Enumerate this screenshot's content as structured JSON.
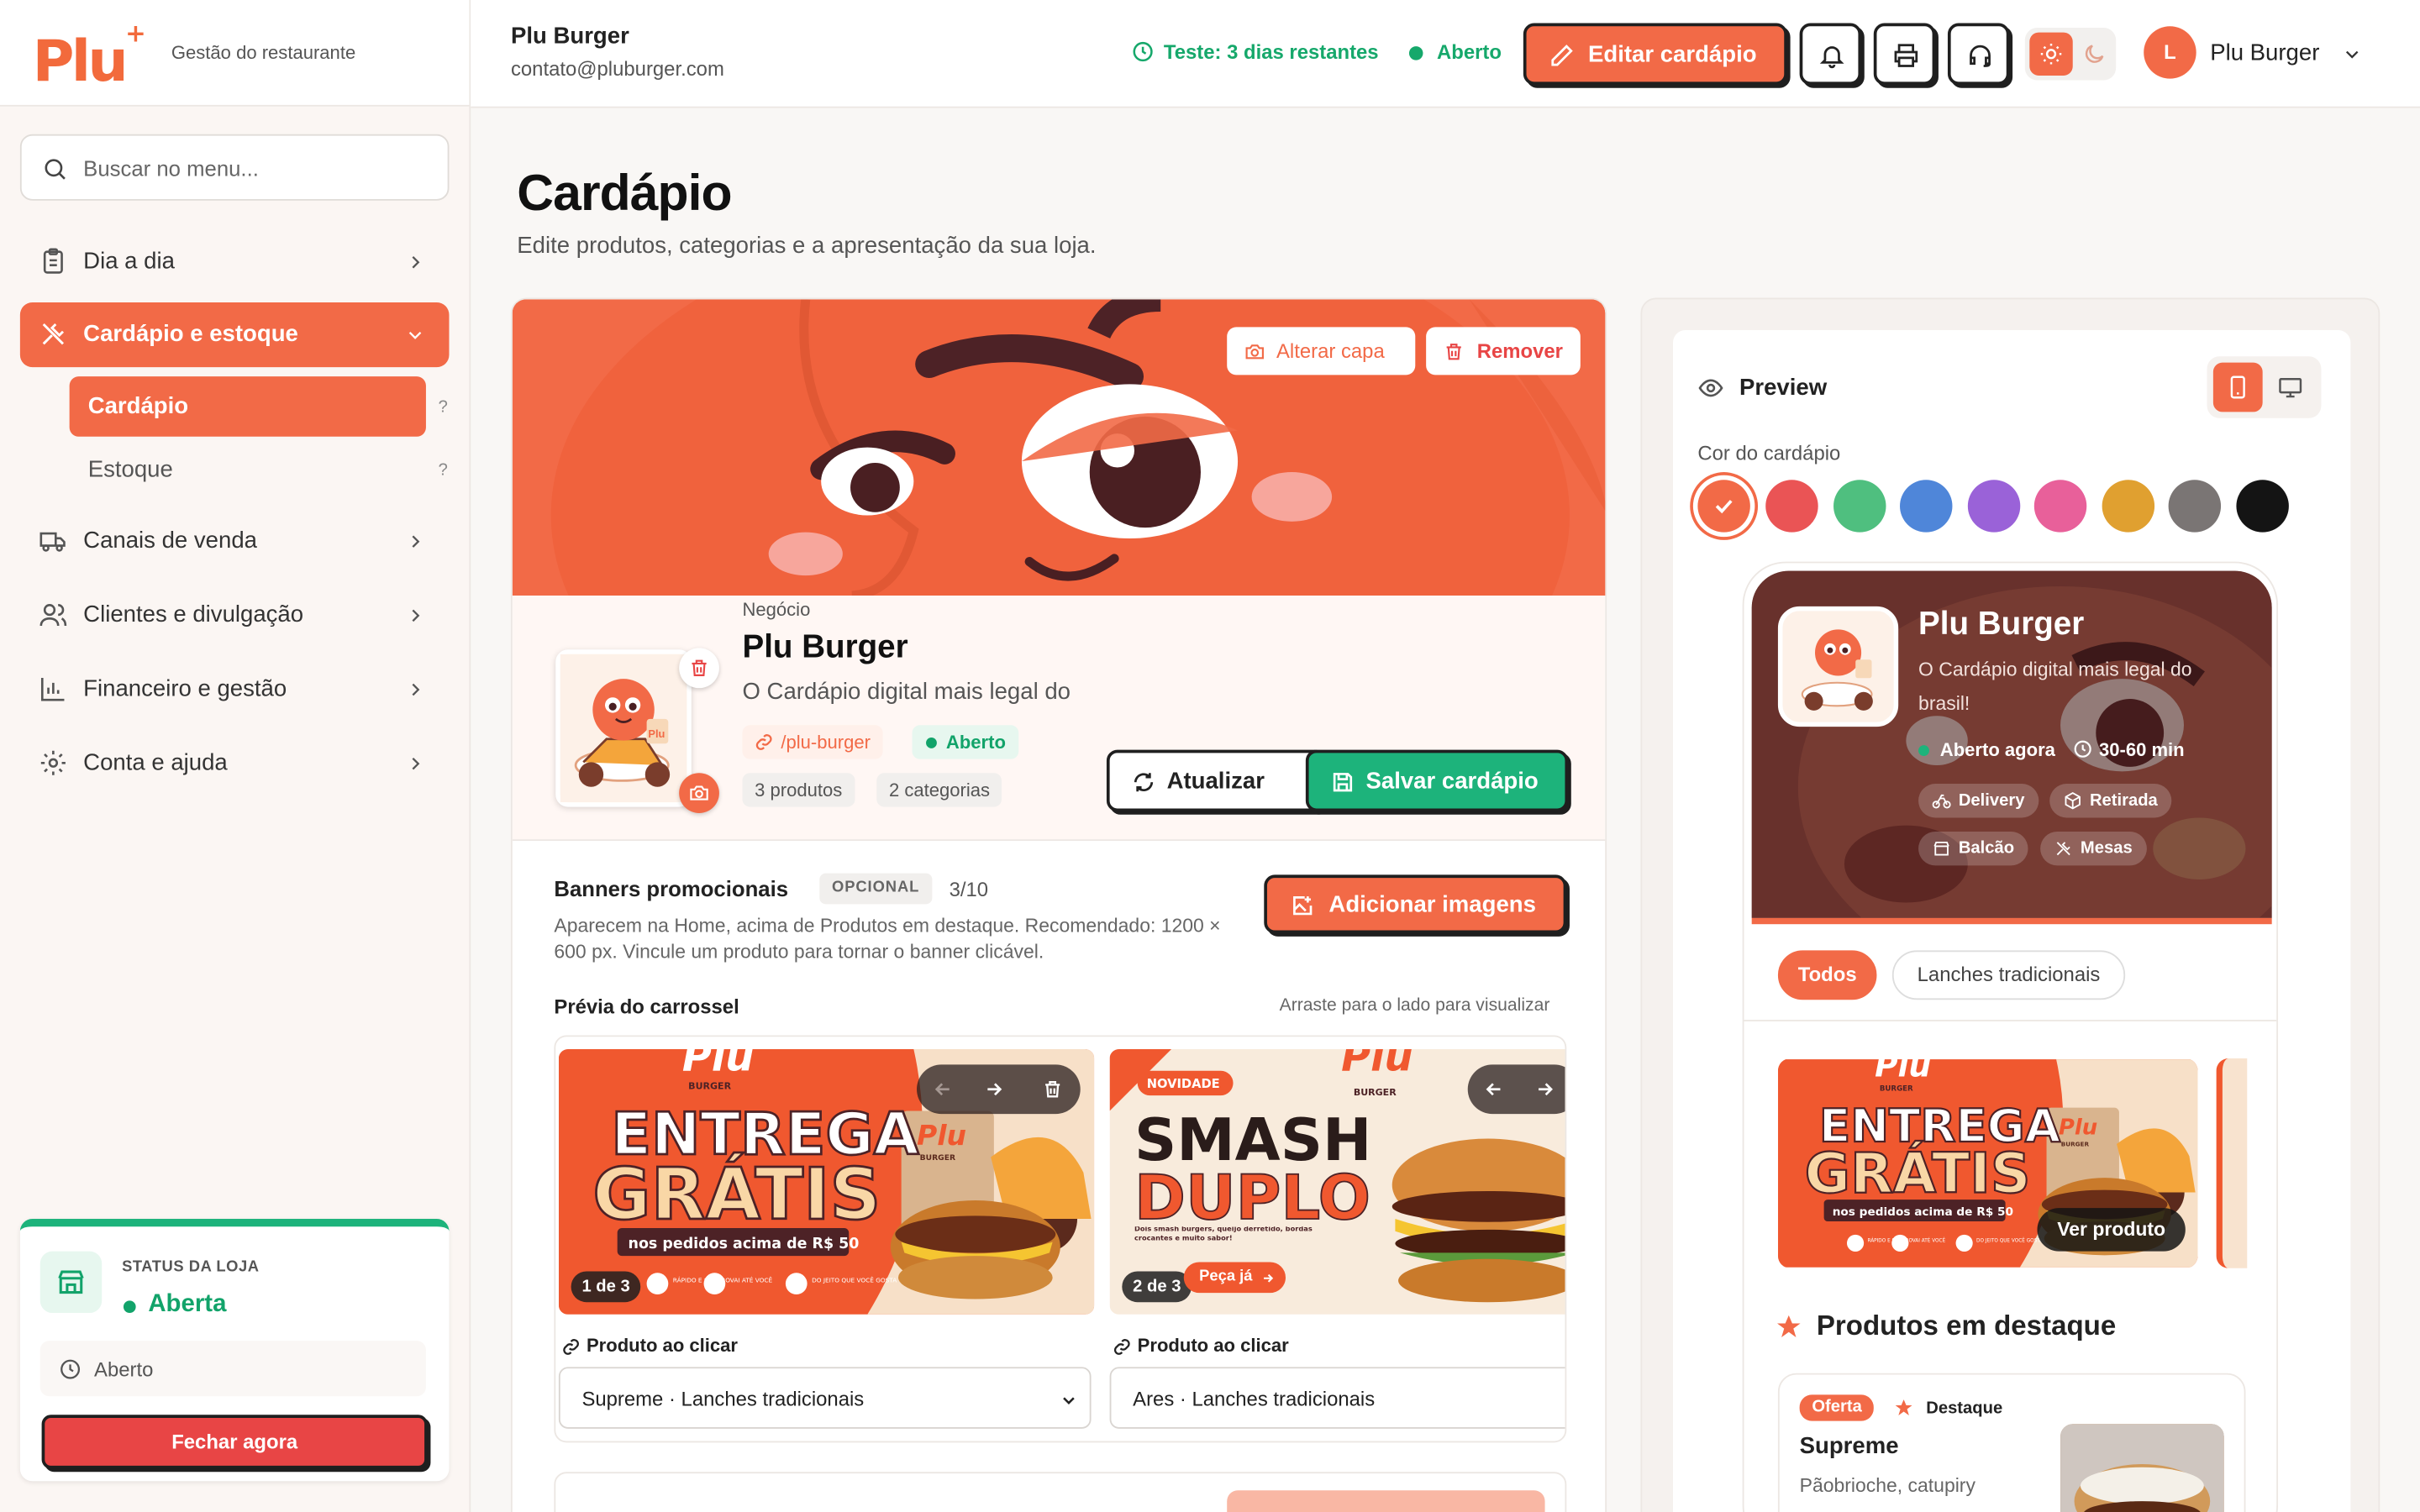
{
  "brand": {
    "logo": "Plu",
    "subtitle": "Gestão do restaurante"
  },
  "search": {
    "placeholder": "Buscar no menu..."
  },
  "nav": {
    "items": [
      {
        "label": "Dia a dia",
        "icon": "clipboard-icon"
      },
      {
        "label": "Cardápio e estoque",
        "icon": "utensils-icon"
      },
      {
        "label": "Canais de venda",
        "icon": "truck-icon"
      },
      {
        "label": "Clientes e divulgação",
        "icon": "users-icon"
      },
      {
        "label": "Financeiro e gestão",
        "icon": "bar-chart-icon"
      },
      {
        "label": "Conta e ajuda",
        "icon": "gear-icon"
      }
    ],
    "sub": [
      {
        "label": "Cardápio",
        "help": "?"
      },
      {
        "label": "Estoque",
        "help": "?"
      }
    ]
  },
  "store_status": {
    "title": "STATUS DA LOJA",
    "status": "Aberta",
    "select": "Aberto",
    "close_button": "Fechar agora"
  },
  "topbar": {
    "name": "Plu Burger",
    "email": "contato@pluburger.com",
    "trial": "Teste: 3 dias restantes",
    "open": "Aberto",
    "edit_button": "Editar cardápio",
    "user_initial": "L",
    "user_name": "Plu Burger"
  },
  "page": {
    "title": "Cardápio",
    "subtitle": "Edite produtos, categorias e a apresentação da sua loja."
  },
  "cover": {
    "change": "Alterar capa",
    "remove": "Remover"
  },
  "business": {
    "label": "Negócio",
    "name": "Plu Burger",
    "description": "O Cardápio digital mais legal do",
    "slug": "/plu-burger",
    "status": "Aberto",
    "products": "3 produtos",
    "categories": "2 categorias",
    "refresh_button": "Atualizar",
    "save_button": "Salvar cardápio",
    "thumb_text": "Plu"
  },
  "banners": {
    "title": "Banners promocionais",
    "badge": "OPCIONAL",
    "count": "3/10",
    "description": "Aparecem na Home, acima de Produtos em destaque. Recomendado: 1200 × 600 px. Vincule um produto para tornar o banner clicável.",
    "add_button": "Adicionar imagens",
    "preview_title": "Prévia do carrossel",
    "preview_hint": "Arraste para o lado para visualizar",
    "items": [
      {
        "page": "1 de 3",
        "logo": "Plu",
        "logo_sub": "BURGER",
        "line1": "ENTREGA",
        "line2": "GRÁTIS",
        "strip": "nos pedidos acima de R$ 50",
        "bag_logo": "Plu",
        "bag_sub": "BURGER",
        "chip1": "RÁPIDO E SEGURO",
        "chip2": "VAI ATÉ VOCÊ",
        "chip3": "DO JEITO QUE VOCÊ GOSTA",
        "link_label": "Produto ao clicar",
        "link_value": "Supreme · Lanches tradicionais"
      },
      {
        "page": "2 de 3",
        "badge": "NOVIDADE",
        "logo": "Plu",
        "logo_sub": "BURGER",
        "line1": "SMASH",
        "line2": "DUPLO",
        "small": "Dois smash burgers, queijo derretido, bordas crocantes e muito sabor!",
        "cta": "Peça já",
        "link_label": "Produto ao clicar",
        "link_value": "Ares · Lanches tradicionais"
      }
    ]
  },
  "preview": {
    "title": "Preview",
    "color_label": "Cor do cardápio",
    "colors": [
      "#f26a47",
      "#ea5455",
      "#4fbf7f",
      "#4f86d9",
      "#9a62d8",
      "#e8609a",
      "#e0a030",
      "#7a7574",
      "#141414"
    ],
    "store_name": "Plu Burger",
    "store_desc": "O Cardápio digital mais legal do brasil!",
    "open": "Aberto agora",
    "time": "30-60 min",
    "badges": [
      "Delivery",
      "Retirada",
      "Balcão",
      "Mesas"
    ],
    "chips": [
      "Todos",
      "Lanches tradicionais"
    ],
    "banner_cta": "Ver produto",
    "featured": "Produtos em destaque",
    "product": {
      "tag1": "Oferta",
      "tag2": "Destaque",
      "name": "Supreme",
      "desc": "Pãobrioche, catupiry"
    }
  },
  "accent": "#f26a47"
}
